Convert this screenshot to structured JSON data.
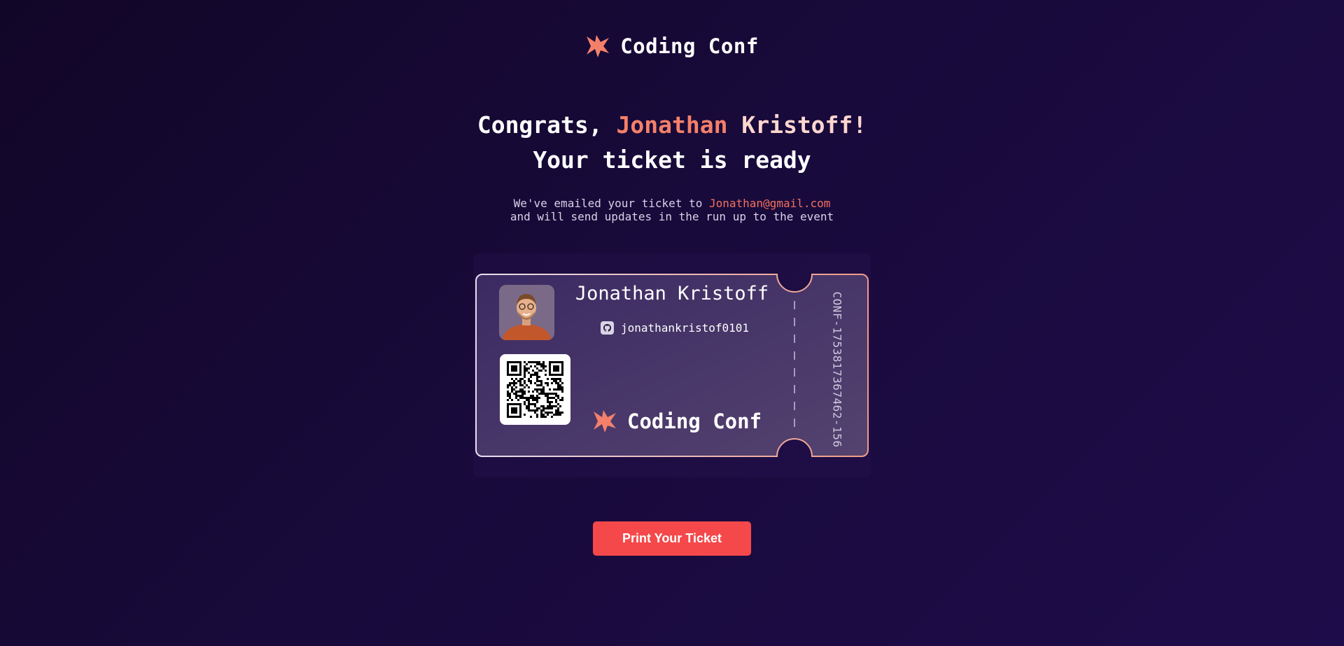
{
  "brand": {
    "name": "Coding Conf",
    "icon": "coding-conf-logo-icon",
    "color": "#f5806a"
  },
  "headline": {
    "congrats_prefix": "Congrats,",
    "first_name": "Jonathan",
    "last_name": "Kristoff!",
    "line2": "Your ticket is ready"
  },
  "subtext": {
    "prefix": "We've emailed your ticket to",
    "email": "Jonathan@gmail.com",
    "line2": "and will send updates in the run up to the event"
  },
  "ticket": {
    "attendee_name": "Jonathan Kristoff",
    "github_icon": "github-icon",
    "github_handle": "jonathankristof0101",
    "brand_name": "Coding Conf",
    "ticket_id": "CONF-1753817367462-156",
    "qr_icon": "qr-code-icon",
    "border_color": "#f29a86"
  },
  "actions": {
    "print_label": "Print Your Ticket",
    "print_color": "#f5484a"
  }
}
